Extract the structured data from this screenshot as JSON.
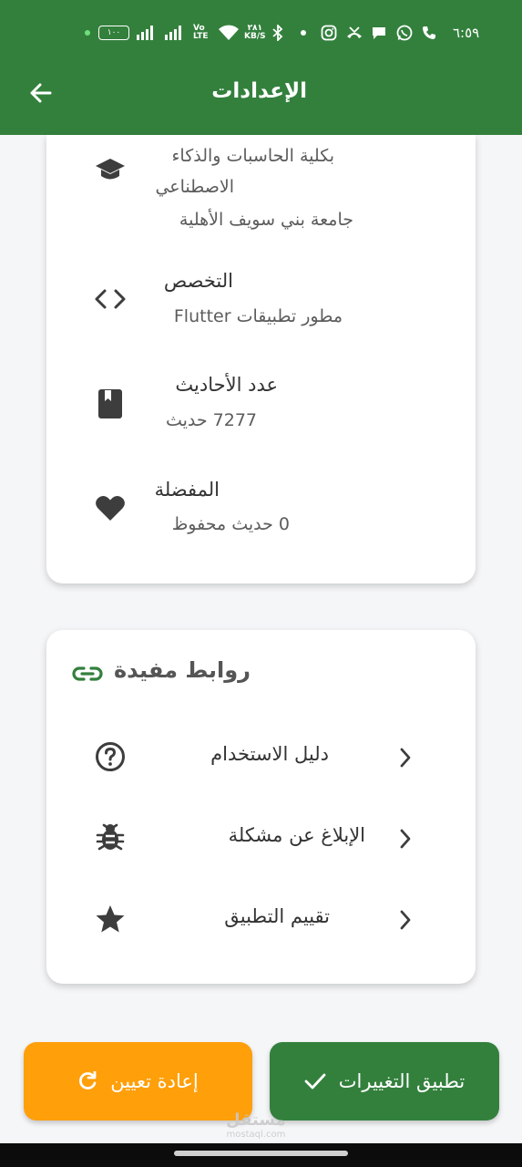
{
  "status_bar": {
    "time": "٦:٥٩",
    "battery": "١٠٠",
    "net_speed_value": "٢٨١",
    "net_speed_unit": "KB/S",
    "volte_top": "Vo",
    "volte_bottom": "LTE",
    "icons": [
      "phone-icon",
      "whatsapp-icon",
      "message-icon",
      "missed-call-icon",
      "instagram-icon",
      "dot-icon",
      "bluetooth-icon",
      "wifi-icon",
      "signal-icon",
      "battery-icon"
    ]
  },
  "header": {
    "title": "الإعدادات",
    "back_icon": "arrow-left-icon"
  },
  "profile_card": {
    "education": {
      "icon": "graduation-cap-icon",
      "line1": "بكلية الحاسبات والذكاء",
      "line2": "الاصطناعي",
      "line3": "جامعة بني سويف الأهلية"
    },
    "specialty": {
      "icon": "code-icon",
      "title": "التخصص",
      "value": "مطور تطبيقات Flutter"
    },
    "hadith_count": {
      "icon": "book-icon",
      "title": "عدد الأحاديث",
      "value": "7277 حديث"
    },
    "favorites": {
      "icon": "heart-icon",
      "title": "المفضلة",
      "value": "0 حديث محفوظ"
    }
  },
  "links_card": {
    "title": "روابط مفيدة",
    "title_icon": "link-icon",
    "items": [
      {
        "label": "دليل الاستخدام",
        "icon": "help-circle-icon"
      },
      {
        "label": "الإبلاغ عن مشكلة",
        "icon": "bug-icon"
      },
      {
        "label": "تقييم التطبيق",
        "icon": "star-icon"
      }
    ]
  },
  "actions": {
    "apply_label": "تطبيق التغييرات",
    "apply_icon": "check-icon",
    "reset_label": "إعادة تعيين",
    "reset_icon": "refresh-icon"
  },
  "watermark": {
    "text": "مستقل",
    "sub": "mostaql.com"
  },
  "colors": {
    "primary": "#33803d",
    "accent": "#ff9f0a",
    "background": "#f5f6f8",
    "card": "#ffffff",
    "icon": "#3d3d3d"
  }
}
